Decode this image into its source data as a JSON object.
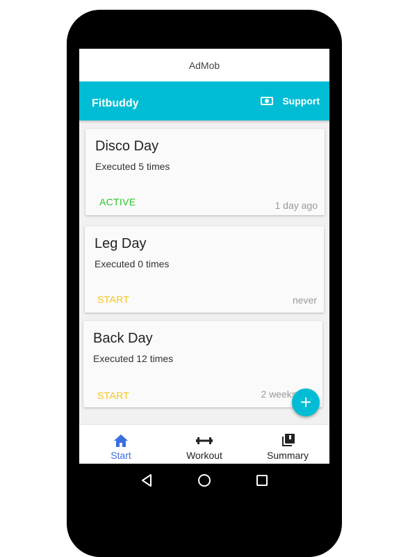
{
  "ad_banner": "AdMob",
  "app_bar": {
    "title": "Fitbuddy",
    "support_label": "Support",
    "support_icon": "money-icon"
  },
  "colors": {
    "primary": "#00bcd4",
    "active": "#2bc42b",
    "start": "#f5c317",
    "nav_active": "#3a6fe0"
  },
  "workouts": [
    {
      "name": "Disco Day",
      "executed": "Executed 5 times",
      "action": "ACTIVE",
      "last": "1 day ago"
    },
    {
      "name": "Leg Day",
      "executed": "Executed 0 times",
      "action": "START",
      "last": "never"
    },
    {
      "name": "Back Day",
      "executed": "Executed 12 times",
      "action": "START",
      "last": "2 weeks ago"
    }
  ],
  "fab_label": "+",
  "bottom_nav": [
    {
      "label": "Start",
      "icon": "home-icon",
      "active": true
    },
    {
      "label": "Workout",
      "icon": "dumbbell-icon",
      "active": false
    },
    {
      "label": "Summary",
      "icon": "library-icon",
      "active": false
    }
  ]
}
